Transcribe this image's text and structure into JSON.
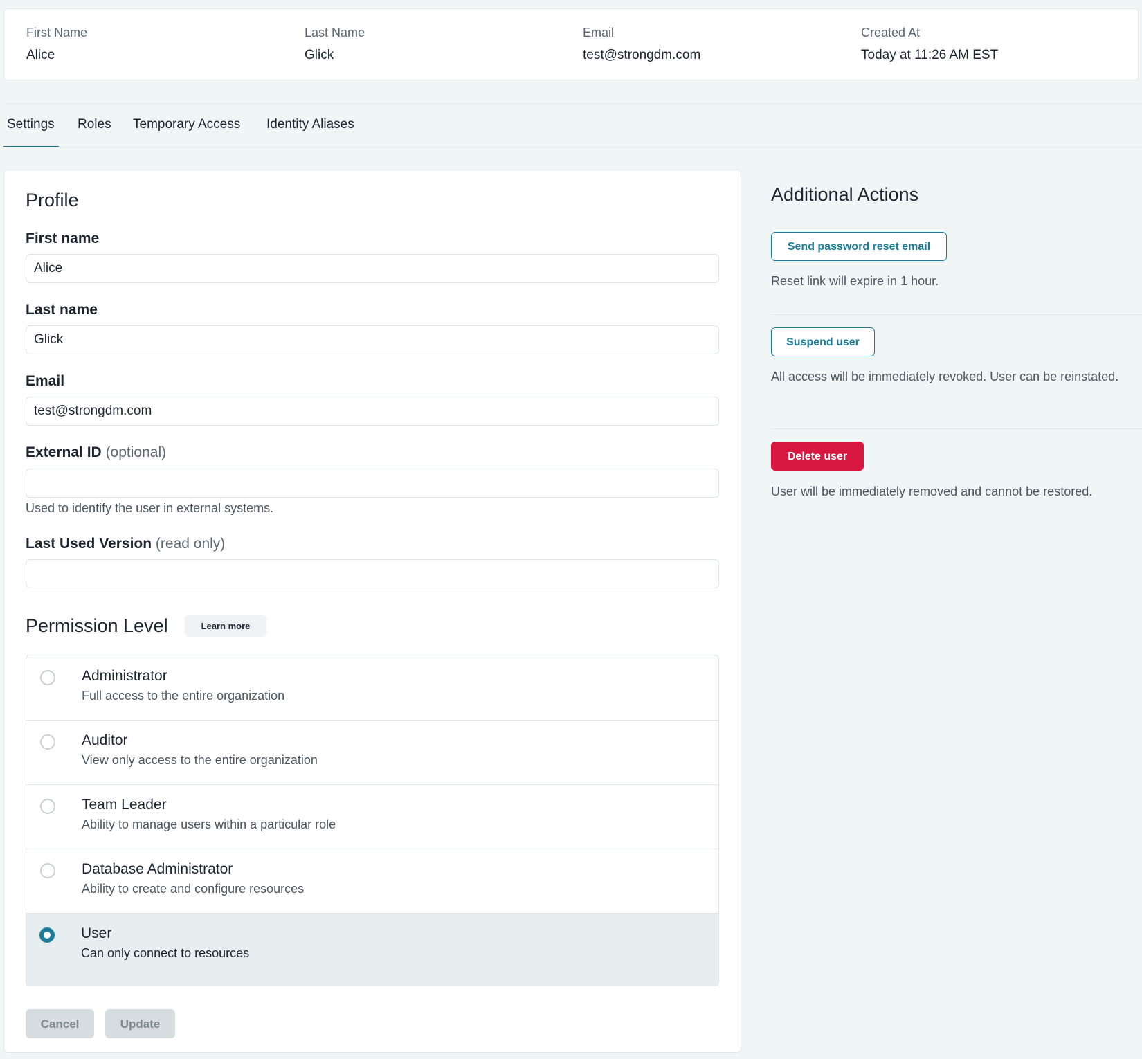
{
  "summary": {
    "first_name_label": "First Name",
    "first_name": "Alice",
    "last_name_label": "Last Name",
    "last_name": "Glick",
    "email_label": "Email",
    "email": "test@strongdm.com",
    "created_label": "Created At",
    "created": "Today at 11:26 AM EST"
  },
  "tabs": [
    {
      "label": "Settings",
      "active": true
    },
    {
      "label": "Roles",
      "active": false
    },
    {
      "label": "Temporary Access",
      "active": false
    },
    {
      "label": "Identity Aliases",
      "active": false
    }
  ],
  "profile": {
    "title": "Profile",
    "first_name_label": "First name",
    "first_name_value": "Alice",
    "last_name_label": "Last name",
    "last_name_value": "Glick",
    "email_label": "Email",
    "email_value": "test@strongdm.com",
    "external_id_label": "External ID",
    "external_id_hint": "(optional)",
    "external_id_value": "",
    "external_id_help": "Used to identify the user in external systems.",
    "version_label": "Last Used Version",
    "version_hint": "(read only)",
    "version_value": ""
  },
  "permission": {
    "title": "Permission Level",
    "learn_more": "Learn more",
    "options": [
      {
        "title": "Administrator",
        "desc": "Full access to the entire organization",
        "selected": false
      },
      {
        "title": "Auditor",
        "desc": "View only access to the entire organization",
        "selected": false
      },
      {
        "title": "Team Leader",
        "desc": "Ability to manage users within a particular role",
        "selected": false
      },
      {
        "title": "Database Administrator",
        "desc": "Ability to create and configure resources",
        "selected": false
      },
      {
        "title": "User",
        "desc": "Can only connect to resources",
        "selected": true
      }
    ]
  },
  "form_buttons": {
    "cancel": "Cancel",
    "update": "Update"
  },
  "actions": {
    "title": "Additional Actions",
    "reset_button": "Send password reset email",
    "reset_text": "Reset link will expire in 1 hour.",
    "suspend_button": "Suspend user",
    "suspend_text": "All access will be immediately revoked. User can be reinstated.",
    "delete_button": "Delete user",
    "delete_text": "User will be immediately removed and cannot be restored."
  },
  "colors": {
    "accent": "#1b7c9a",
    "danger": "#d7173f",
    "background": "#f0f5f6"
  }
}
